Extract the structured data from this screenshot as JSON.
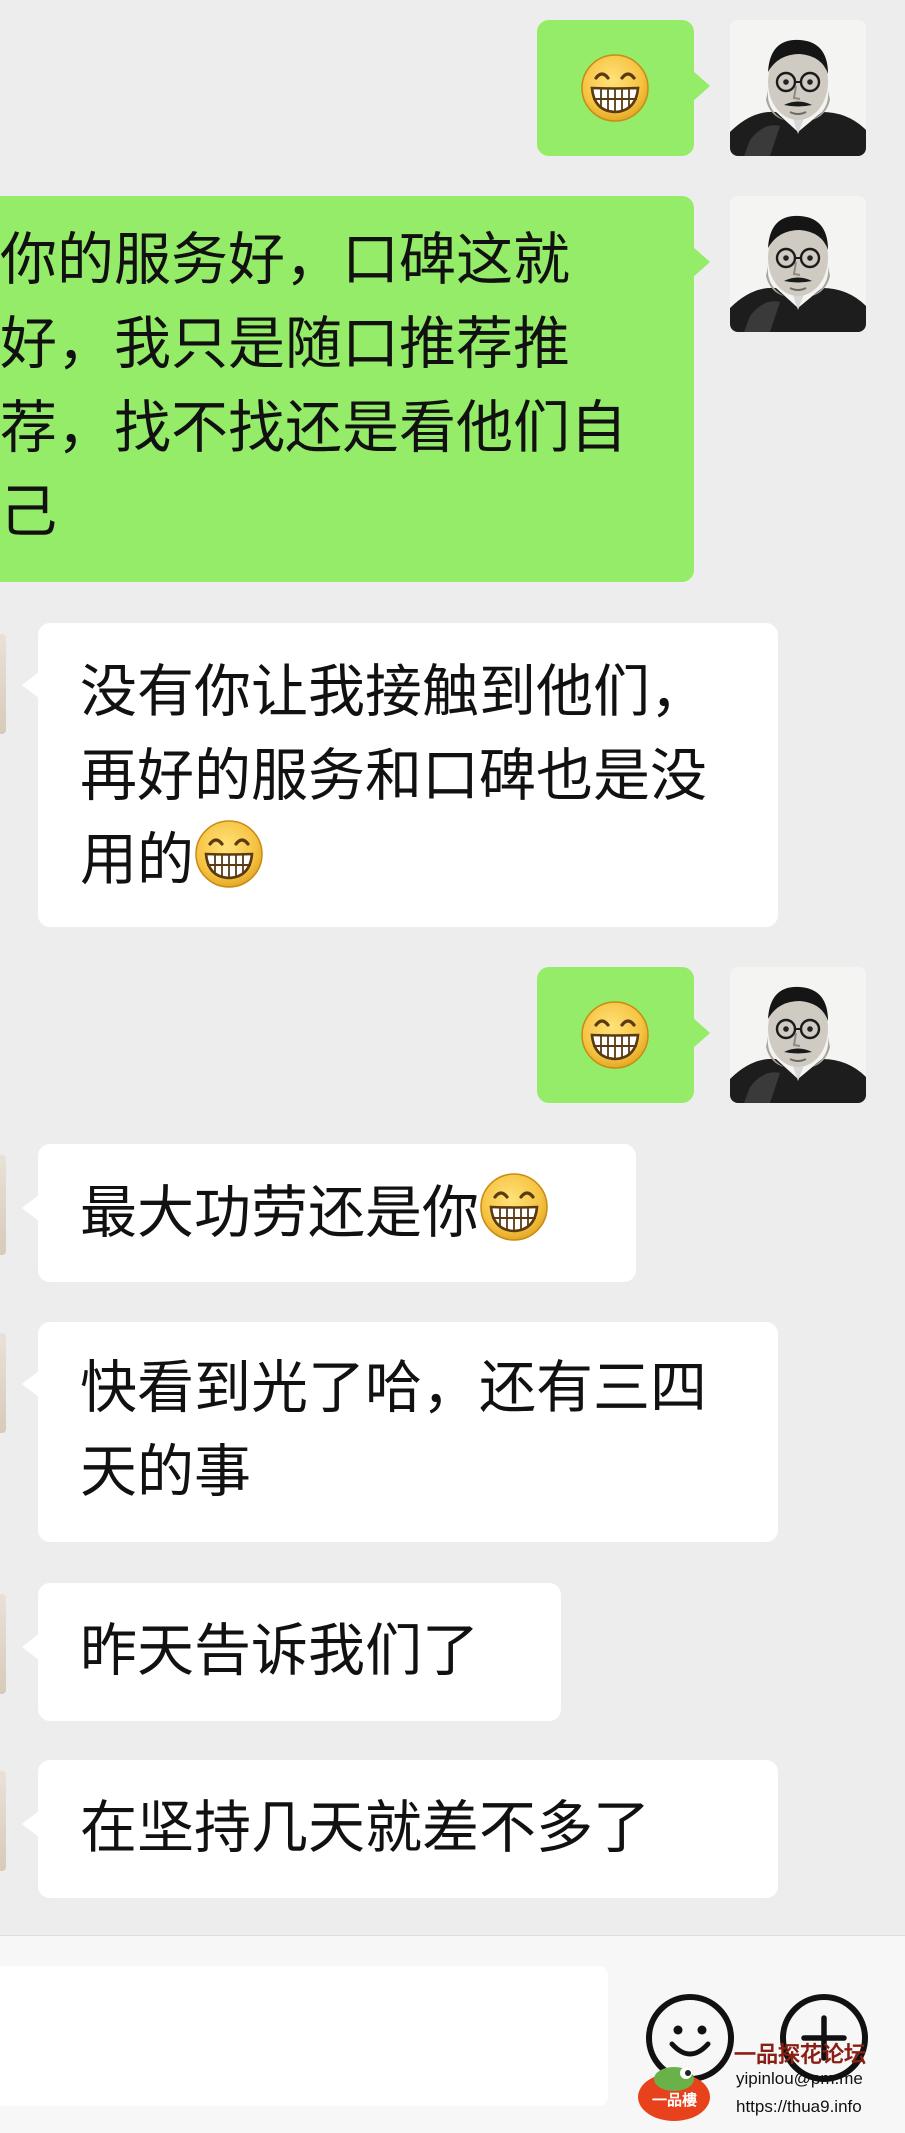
{
  "messages": [
    {
      "side": "sent",
      "type": "emoji",
      "emoji": "grinning-face-emoji"
    },
    {
      "side": "sent",
      "type": "text",
      "text": "你的服务好，口碑这就好，我只是随口推荐推荐，找不找还是看他们自己"
    },
    {
      "side": "received",
      "type": "text",
      "text": "没有你让我接触到他们，再好的服务和口碑也是没用的",
      "trailing_emoji": "grinning-face-emoji"
    },
    {
      "side": "sent",
      "type": "emoji",
      "emoji": "grinning-face-emoji"
    },
    {
      "side": "received",
      "type": "text",
      "text": "最大功劳还是你",
      "trailing_emoji": "grinning-face-emoji"
    },
    {
      "side": "received",
      "type": "text",
      "text": "快看到光了哈，还有三四天的事"
    },
    {
      "side": "received",
      "type": "text",
      "text": "昨天告诉我们了"
    },
    {
      "side": "received",
      "type": "text",
      "text": "在坚持几天就差不多了"
    }
  ],
  "input_bar": {
    "input_value": "",
    "emoji_button_icon": "smiley-face-icon",
    "more_button_icon": "plus-circle-icon"
  },
  "watermark": {
    "title": "一品探花论坛",
    "email": "yipinlou@pm.me",
    "url": "https://thua9.info",
    "logo_text": "一品樓"
  },
  "colors": {
    "background": "#ededed",
    "sent_bubble": "#95ec69",
    "received_bubble": "#ffffff",
    "text": "#111111",
    "emoji_face": "#f6c342"
  }
}
